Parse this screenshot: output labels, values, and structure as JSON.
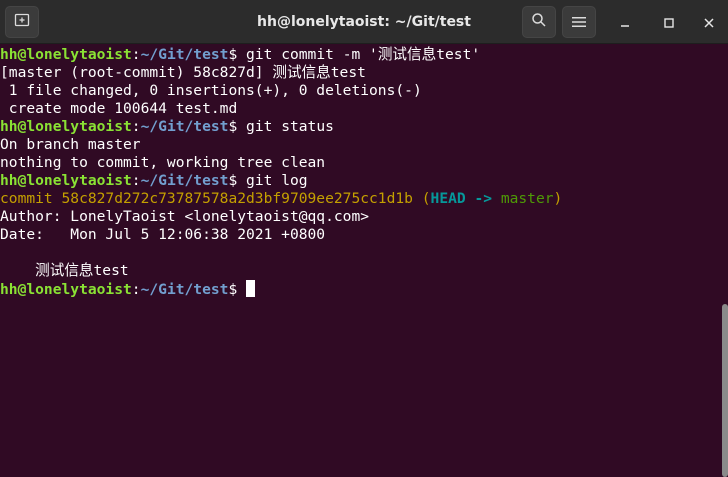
{
  "window": {
    "title": "hh@lonelytaoist: ~/Git/test"
  },
  "icons": {
    "new_tab": "new-tab-icon",
    "search": "search-icon",
    "menu": "hamburger-menu-icon",
    "minimize": "minimize-icon",
    "maximize": "maximize-icon",
    "close": "close-icon"
  },
  "colors": {
    "background": "#300a24",
    "titlebar": "#2c2c2c",
    "prompt_user": "#8ae234",
    "prompt_path": "#729fcf",
    "commit_hash": "#c4a000",
    "head": "#06989a",
    "branch": "#4e9a06"
  },
  "prompt": {
    "userhost": "hh@lonelytaoist",
    "sep": ":",
    "path": "~/Git/test",
    "dollar": "$ "
  },
  "commands": [
    "git commit -m '测试信息test'",
    "git status",
    "git log"
  ],
  "output": {
    "commit_result": [
      "[master (root-commit) 58c827d] 测试信息test",
      " 1 file changed, 0 insertions(+), 0 deletions(-)",
      " create mode 100644 test.md"
    ],
    "status": [
      "On branch master",
      "nothing to commit, working tree clean"
    ],
    "log": {
      "commit_line": "commit 58c827d272c73787578a2d3bf9709ee275cc1d1b",
      "open_paren": " (",
      "head": "HEAD -> ",
      "branch": "master",
      "close_paren": ")",
      "author": "Author: LonelyTaoist <lonelytaoist@qq.com>",
      "date": "Date:   Mon Jul 5 12:06:38 2021 +0800",
      "message": "    测试信息test"
    }
  }
}
